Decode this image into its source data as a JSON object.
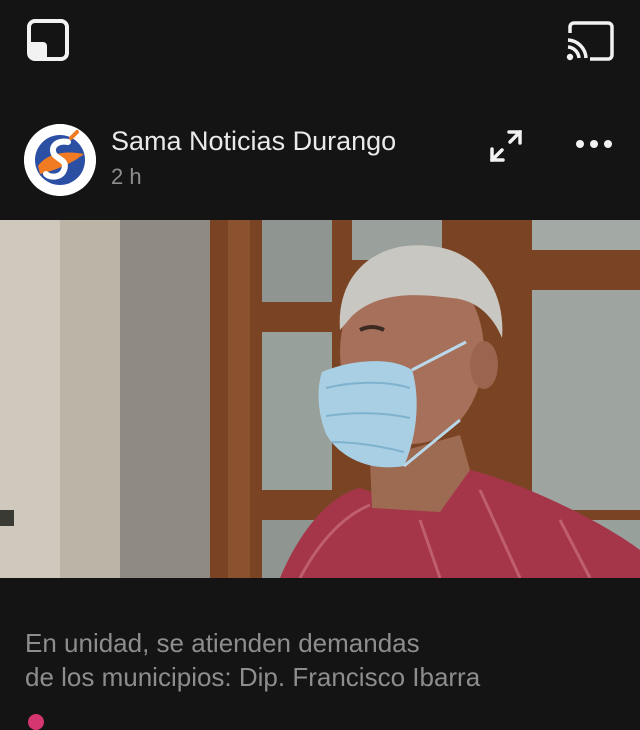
{
  "toolbar": {
    "pip_icon": "picture-in-picture-icon",
    "cast_icon": "cast-icon"
  },
  "post": {
    "page_name": "Sama Noticias Durango",
    "time": "2 h",
    "expand_icon": "expand-icon",
    "more_icon": "more-options-icon",
    "avatar_logo": "Sama Noticias logo"
  },
  "caption": {
    "line1": "En unidad, se atienden demandas",
    "line2": "de los municipios: Dip. Francisco Ibarra"
  },
  "colors": {
    "background": "#141414",
    "text_primary": "#e9e9e9",
    "text_secondary": "#8e8e8e",
    "logo_blue": "#2b4fa3",
    "logo_orange": "#f07b22"
  }
}
